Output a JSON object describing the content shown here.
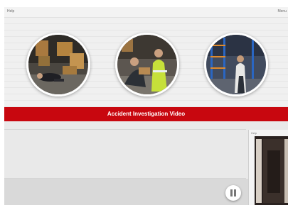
{
  "topbar": {
    "help_label": "Help",
    "menu_label": "Menu"
  },
  "banner": {
    "title": "Accident Investigation Video",
    "color": "#c8070f"
  },
  "photos": [
    {
      "name": "warehouse-injured-worker-photo"
    },
    {
      "name": "first-aid-responders-photo"
    },
    {
      "name": "warehouse-racking-inspection-photo"
    }
  ],
  "side_panel": {
    "help_label": "Help"
  },
  "player": {
    "control": "pause-icon"
  }
}
